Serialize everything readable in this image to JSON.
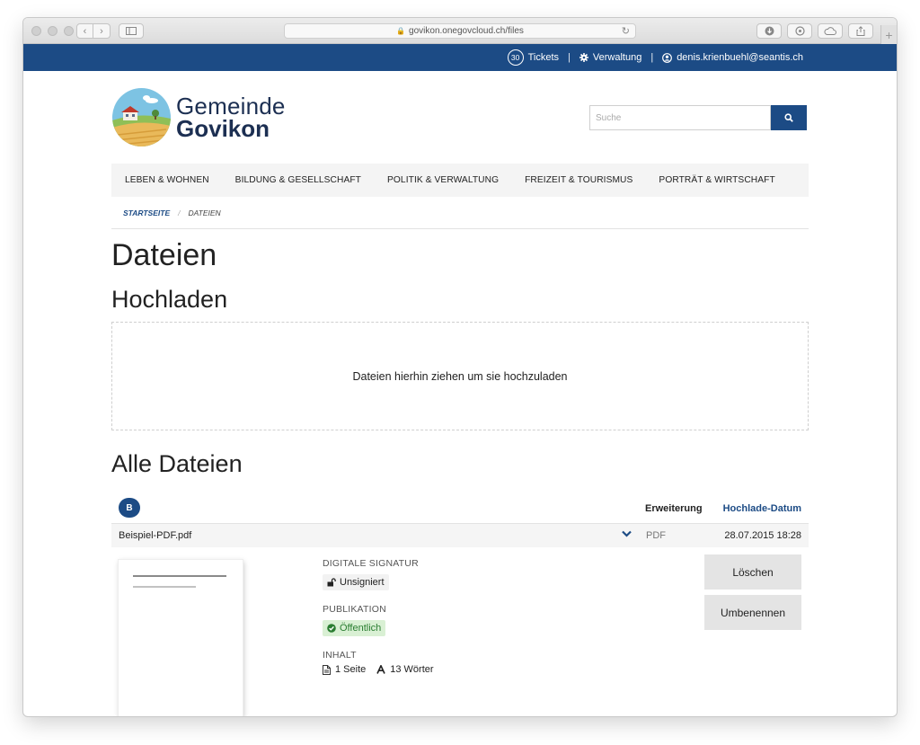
{
  "browser": {
    "url": "govikon.onegovcloud.ch/files"
  },
  "topbar": {
    "tickets_count": "30",
    "tickets_label": "Tickets",
    "admin_label": "Verwaltung",
    "user_email": "denis.krienbuehl@seantis.ch"
  },
  "logo": {
    "line1": "Gemeinde",
    "line2": "Govikon"
  },
  "search": {
    "placeholder": "Suche"
  },
  "nav": {
    "items": [
      "LEBEN & WOHNEN",
      "BILDUNG & GESELLSCHAFT",
      "POLITIK & VERWALTUNG",
      "FREIZEIT & TOURISMUS",
      "PORTRÄT & WIRTSCHAFT"
    ]
  },
  "breadcrumb": {
    "home": "STARTSEITE",
    "separator": "/",
    "current": "DATEIEN"
  },
  "page": {
    "title": "Dateien",
    "upload_heading": "Hochladen",
    "dropzone_text": "Dateien hierhin ziehen um sie hochzuladen",
    "all_files_heading": "Alle Dateien"
  },
  "table": {
    "letter": "B",
    "col_extension": "Erweiterung",
    "col_upload_date": "Hochlade-Datum",
    "rows": [
      {
        "name": "Beispiel-PDF.pdf",
        "extension": "PDF",
        "date": "28.07.2015 18:28"
      }
    ]
  },
  "details": {
    "signature_label": "DIGITALE SIGNATUR",
    "signature_value": "Unsigniert",
    "publication_label": "PUBLIKATION",
    "publication_value": "Öffentlich",
    "content_label": "INHALT",
    "pages": "1 Seite",
    "words": "13 Wörter"
  },
  "actions": {
    "delete": "Löschen",
    "rename": "Umbenennen"
  },
  "colors": {
    "brand": "#1c4b85",
    "public_green": "#2a7d31"
  }
}
